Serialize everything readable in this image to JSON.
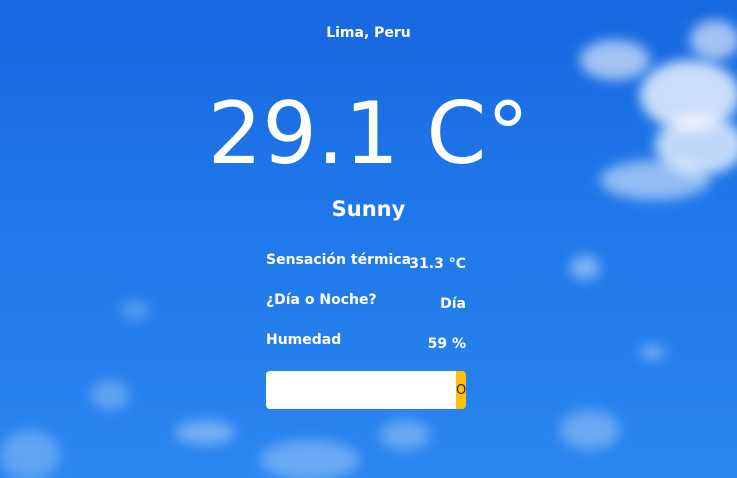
{
  "location": "Lima, Peru",
  "temperature": "29.1 C°",
  "condition": "Sunny",
  "details": [
    {
      "label": "Sensación térmica",
      "value": "31.3 °C"
    },
    {
      "label": "¿Día o Noche?",
      "value": "Día"
    },
    {
      "label": "Humedad",
      "value": "59 %"
    }
  ],
  "search": {
    "placeholder": "",
    "value": "",
    "button_label": "O"
  },
  "colors": {
    "sky": "#1f78ea",
    "button": "#ffc107",
    "text": "#ffffff"
  }
}
